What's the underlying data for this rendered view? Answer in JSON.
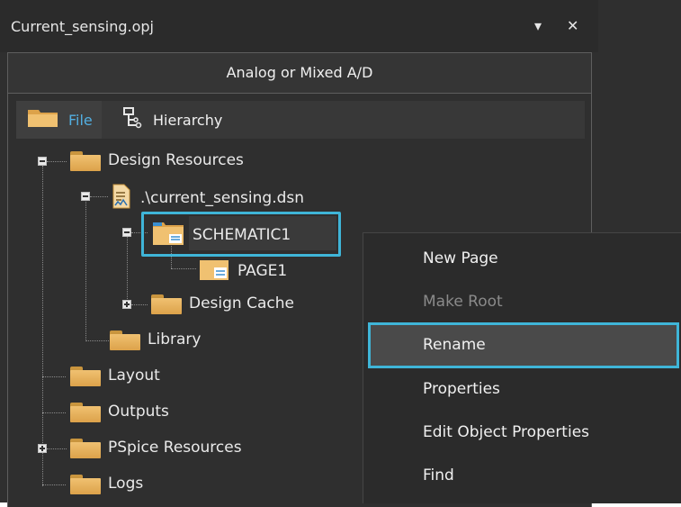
{
  "window": {
    "title": "Current_sensing.opj",
    "pin_glyph": "▾",
    "close_glyph": "✕"
  },
  "mode_strip": {
    "label": "Analog or Mixed A/D"
  },
  "tabs": [
    {
      "label": "File",
      "icon": "folder-icon",
      "active": true
    },
    {
      "label": "Hierarchy",
      "icon": "hierarchy-icon",
      "active": false
    }
  ],
  "tree": {
    "design_resources": "Design Resources",
    "design_file": ".\\current_sensing.dsn",
    "schematic": "SCHEMATIC1",
    "page": "PAGE1",
    "design_cache": "Design Cache",
    "library": "Library",
    "layout": "Layout",
    "outputs": "Outputs",
    "pspice_resources": "PSpice Resources",
    "logs": "Logs"
  },
  "context_menu": {
    "items": [
      {
        "label": "New Page",
        "enabled": true
      },
      {
        "label": "Make Root",
        "enabled": false
      },
      {
        "label": "Rename",
        "enabled": true,
        "highlighted": true
      },
      {
        "label": "Properties",
        "enabled": true
      },
      {
        "label": "Edit Object Properties",
        "enabled": true
      },
      {
        "label": "Find",
        "enabled": true
      }
    ]
  },
  "colors": {
    "highlight": "#3fb5d8",
    "active_tab_text": "#52aee0",
    "folder": "#dca24a"
  }
}
